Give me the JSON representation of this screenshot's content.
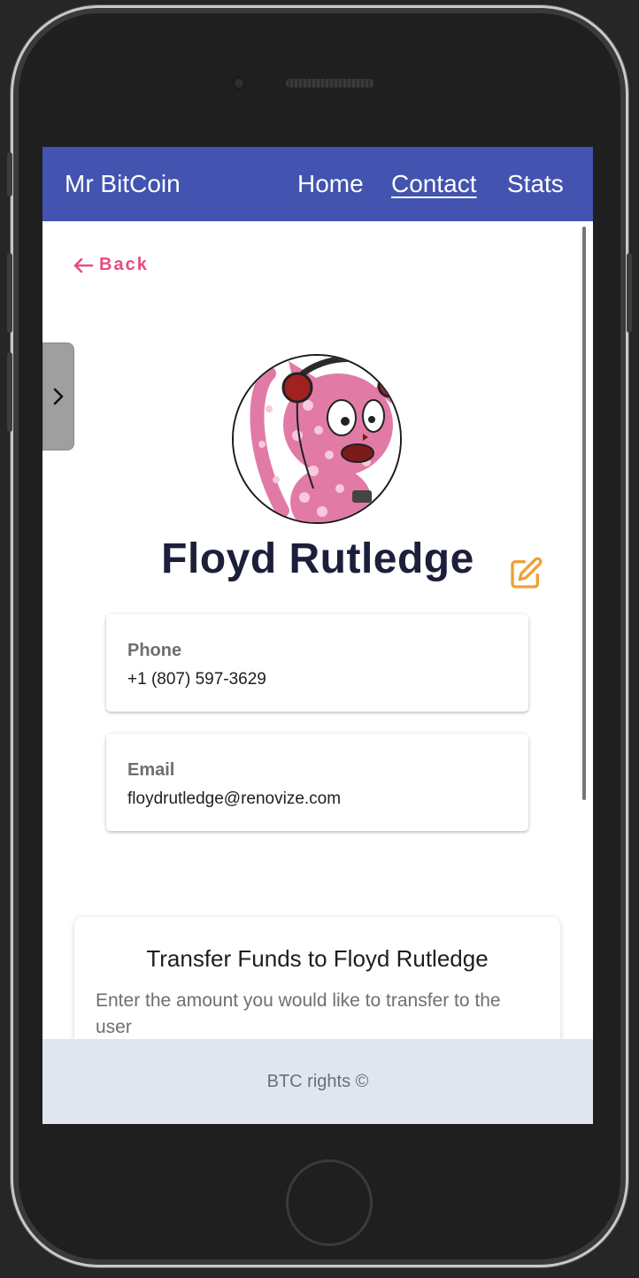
{
  "navbar": {
    "brand": "Mr BitCoin",
    "links": [
      {
        "label": "Home",
        "active": false
      },
      {
        "label": "Contact",
        "active": true
      },
      {
        "label": "Stats",
        "active": false
      }
    ],
    "color": "#4253b0"
  },
  "back": {
    "label": "Back",
    "icon": "arrow-left-icon",
    "color": "#e94b7b"
  },
  "drawer_toggle": {
    "icon": "chevron-right-icon"
  },
  "contact": {
    "avatar_icon": "pink-cat-avatar",
    "name": "Floyd Rutledge",
    "edit_icon": "edit-icon",
    "fields": [
      {
        "label": "Phone",
        "value": "+1 (807) 597-3629"
      },
      {
        "label": "Email",
        "value": "floydrutledge@renovize.com"
      }
    ]
  },
  "transfer": {
    "title": "Transfer Funds to Floyd Rutledge",
    "description": "Enter the amount you would like to transfer to the user"
  },
  "footer": {
    "text": "BTC rights ©"
  }
}
